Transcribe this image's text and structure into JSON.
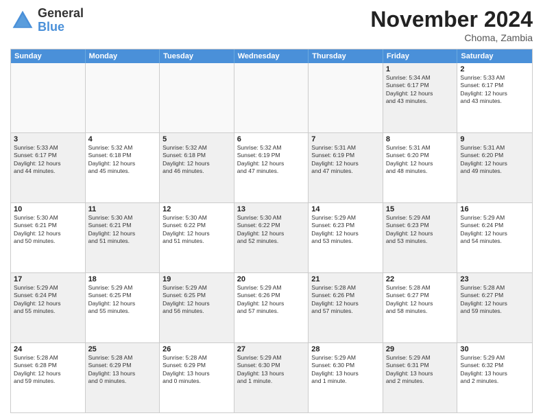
{
  "header": {
    "logo_general": "General",
    "logo_blue": "Blue",
    "month_title": "November 2024",
    "location": "Choma, Zambia"
  },
  "calendar": {
    "days_of_week": [
      "Sunday",
      "Monday",
      "Tuesday",
      "Wednesday",
      "Thursday",
      "Friday",
      "Saturday"
    ],
    "rows": [
      [
        {
          "day": "",
          "info": "",
          "empty": true
        },
        {
          "day": "",
          "info": "",
          "empty": true
        },
        {
          "day": "",
          "info": "",
          "empty": true
        },
        {
          "day": "",
          "info": "",
          "empty": true
        },
        {
          "day": "",
          "info": "",
          "empty": true
        },
        {
          "day": "1",
          "info": "Sunrise: 5:34 AM\nSunset: 6:17 PM\nDaylight: 12 hours\nand 43 minutes.",
          "shaded": true
        },
        {
          "day": "2",
          "info": "Sunrise: 5:33 AM\nSunset: 6:17 PM\nDaylight: 12 hours\nand 43 minutes.",
          "shaded": false
        }
      ],
      [
        {
          "day": "3",
          "info": "Sunrise: 5:33 AM\nSunset: 6:17 PM\nDaylight: 12 hours\nand 44 minutes.",
          "shaded": true
        },
        {
          "day": "4",
          "info": "Sunrise: 5:32 AM\nSunset: 6:18 PM\nDaylight: 12 hours\nand 45 minutes.",
          "shaded": false
        },
        {
          "day": "5",
          "info": "Sunrise: 5:32 AM\nSunset: 6:18 PM\nDaylight: 12 hours\nand 46 minutes.",
          "shaded": true
        },
        {
          "day": "6",
          "info": "Sunrise: 5:32 AM\nSunset: 6:19 PM\nDaylight: 12 hours\nand 47 minutes.",
          "shaded": false
        },
        {
          "day": "7",
          "info": "Sunrise: 5:31 AM\nSunset: 6:19 PM\nDaylight: 12 hours\nand 47 minutes.",
          "shaded": true
        },
        {
          "day": "8",
          "info": "Sunrise: 5:31 AM\nSunset: 6:20 PM\nDaylight: 12 hours\nand 48 minutes.",
          "shaded": false
        },
        {
          "day": "9",
          "info": "Sunrise: 5:31 AM\nSunset: 6:20 PM\nDaylight: 12 hours\nand 49 minutes.",
          "shaded": true
        }
      ],
      [
        {
          "day": "10",
          "info": "Sunrise: 5:30 AM\nSunset: 6:21 PM\nDaylight: 12 hours\nand 50 minutes.",
          "shaded": false
        },
        {
          "day": "11",
          "info": "Sunrise: 5:30 AM\nSunset: 6:21 PM\nDaylight: 12 hours\nand 51 minutes.",
          "shaded": true
        },
        {
          "day": "12",
          "info": "Sunrise: 5:30 AM\nSunset: 6:22 PM\nDaylight: 12 hours\nand 51 minutes.",
          "shaded": false
        },
        {
          "day": "13",
          "info": "Sunrise: 5:30 AM\nSunset: 6:22 PM\nDaylight: 12 hours\nand 52 minutes.",
          "shaded": true
        },
        {
          "day": "14",
          "info": "Sunrise: 5:29 AM\nSunset: 6:23 PM\nDaylight: 12 hours\nand 53 minutes.",
          "shaded": false
        },
        {
          "day": "15",
          "info": "Sunrise: 5:29 AM\nSunset: 6:23 PM\nDaylight: 12 hours\nand 53 minutes.",
          "shaded": true
        },
        {
          "day": "16",
          "info": "Sunrise: 5:29 AM\nSunset: 6:24 PM\nDaylight: 12 hours\nand 54 minutes.",
          "shaded": false
        }
      ],
      [
        {
          "day": "17",
          "info": "Sunrise: 5:29 AM\nSunset: 6:24 PM\nDaylight: 12 hours\nand 55 minutes.",
          "shaded": true
        },
        {
          "day": "18",
          "info": "Sunrise: 5:29 AM\nSunset: 6:25 PM\nDaylight: 12 hours\nand 55 minutes.",
          "shaded": false
        },
        {
          "day": "19",
          "info": "Sunrise: 5:29 AM\nSunset: 6:25 PM\nDaylight: 12 hours\nand 56 minutes.",
          "shaded": true
        },
        {
          "day": "20",
          "info": "Sunrise: 5:29 AM\nSunset: 6:26 PM\nDaylight: 12 hours\nand 57 minutes.",
          "shaded": false
        },
        {
          "day": "21",
          "info": "Sunrise: 5:28 AM\nSunset: 6:26 PM\nDaylight: 12 hours\nand 57 minutes.",
          "shaded": true
        },
        {
          "day": "22",
          "info": "Sunrise: 5:28 AM\nSunset: 6:27 PM\nDaylight: 12 hours\nand 58 minutes.",
          "shaded": false
        },
        {
          "day": "23",
          "info": "Sunrise: 5:28 AM\nSunset: 6:27 PM\nDaylight: 12 hours\nand 59 minutes.",
          "shaded": true
        }
      ],
      [
        {
          "day": "24",
          "info": "Sunrise: 5:28 AM\nSunset: 6:28 PM\nDaylight: 12 hours\nand 59 minutes.",
          "shaded": false
        },
        {
          "day": "25",
          "info": "Sunrise: 5:28 AM\nSunset: 6:29 PM\nDaylight: 13 hours\nand 0 minutes.",
          "shaded": true
        },
        {
          "day": "26",
          "info": "Sunrise: 5:28 AM\nSunset: 6:29 PM\nDaylight: 13 hours\nand 0 minutes.",
          "shaded": false
        },
        {
          "day": "27",
          "info": "Sunrise: 5:29 AM\nSunset: 6:30 PM\nDaylight: 13 hours\nand 1 minute.",
          "shaded": true
        },
        {
          "day": "28",
          "info": "Sunrise: 5:29 AM\nSunset: 6:30 PM\nDaylight: 13 hours\nand 1 minute.",
          "shaded": false
        },
        {
          "day": "29",
          "info": "Sunrise: 5:29 AM\nSunset: 6:31 PM\nDaylight: 13 hours\nand 2 minutes.",
          "shaded": true
        },
        {
          "day": "30",
          "info": "Sunrise: 5:29 AM\nSunset: 6:32 PM\nDaylight: 13 hours\nand 2 minutes.",
          "shaded": false
        }
      ]
    ]
  }
}
